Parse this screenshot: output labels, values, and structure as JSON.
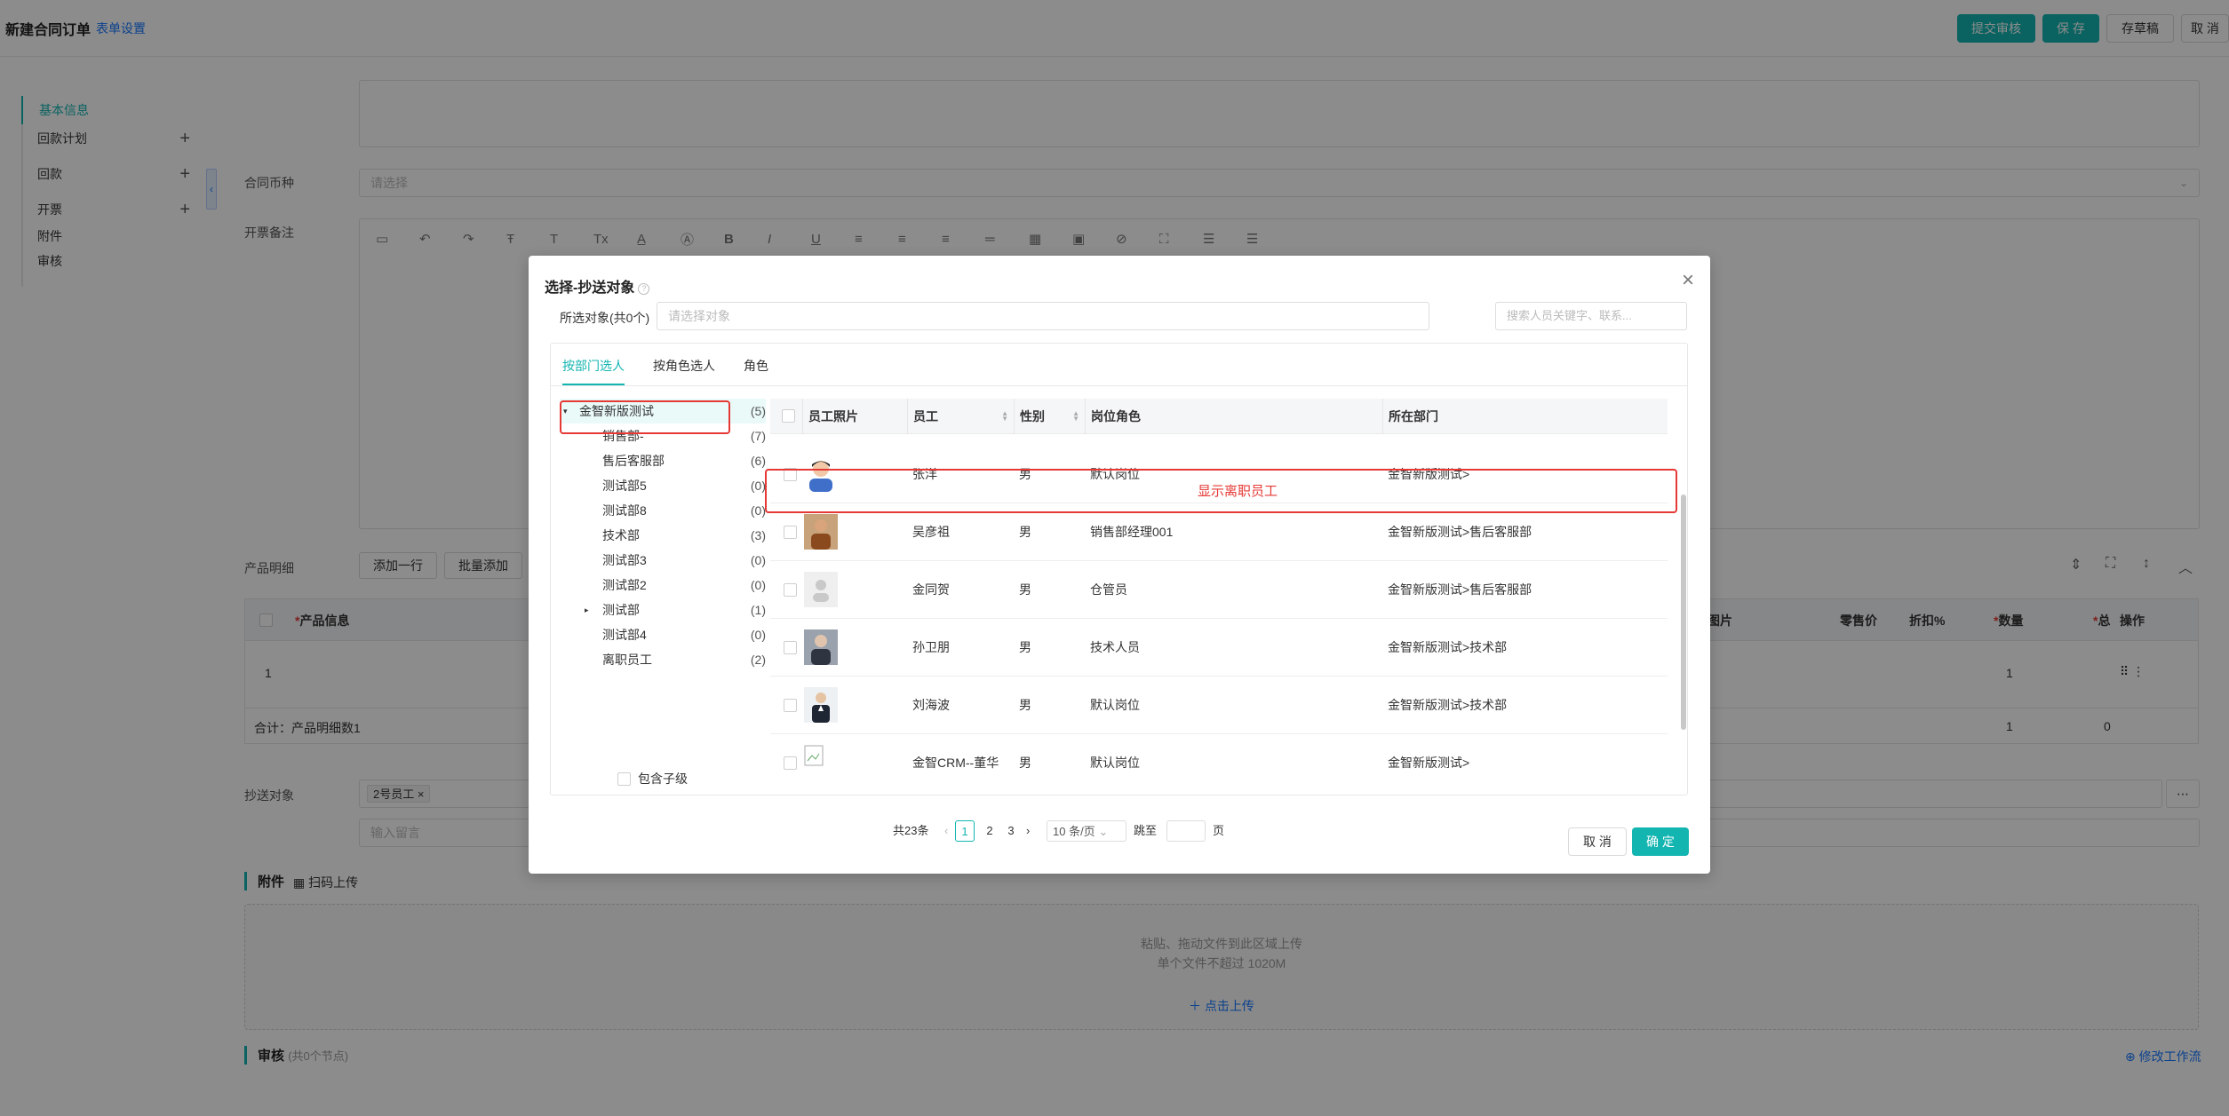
{
  "page": {
    "title": "新建合同订单",
    "form_settings": "表单设置",
    "buttons": {
      "submit": "提交审核",
      "save": "保 存",
      "draft": "存草稿",
      "cancel": "取 消"
    },
    "side_nav": [
      {
        "label": "基本信息",
        "active": true,
        "plus": false
      },
      {
        "label": "回款计划",
        "active": false,
        "plus": true
      },
      {
        "label": "回款",
        "active": false,
        "plus": true
      },
      {
        "label": "开票",
        "active": false,
        "plus": true
      },
      {
        "label": "附件",
        "active": false,
        "plus": false
      },
      {
        "label": "审核",
        "active": false,
        "plus": false
      }
    ],
    "currency_label": "合同币种",
    "currency_placeholder": "请选择",
    "invoice_note_label": "开票备注",
    "product_detail_label": "产品明细",
    "add_row": "添加一行",
    "batch_add": "批量添加",
    "grid_headers": {
      "product": "产品信息",
      "photo": "图片",
      "price": "零售价",
      "discount": "折扣%",
      "qty": "数量",
      "total": "总",
      "action": "操作"
    },
    "grid_row": {
      "index": "1",
      "qty": "1"
    },
    "grid_total": {
      "label": "合计：产品明细数1",
      "qty": "1",
      "total": "0"
    },
    "cc_label": "抄送对象",
    "cc_tag": "2号员工",
    "message_placeholder": "输入留言",
    "attachment_title": "附件",
    "scan_upload": "扫码上传",
    "upload_hint1": "粘贴、拖动文件到此区域上传",
    "upload_hint2": "单个文件不超过 1020M",
    "upload_link": "点击上传",
    "review_title": "审核",
    "review_sub": "(共0个节点)",
    "edit_workflow": "修改工作流"
  },
  "modal": {
    "title": "选择-抄送对象",
    "selected_label": "所选对象(共0个)",
    "selected_placeholder": "请选择对象",
    "search_placeholder": "搜索人员关键字、联系...",
    "tabs": [
      "按部门选人",
      "按角色选人",
      "角色"
    ],
    "tree": [
      {
        "label": "金智新版测试",
        "count": "(5)",
        "level": 0,
        "expanded": true,
        "root": true
      },
      {
        "label": "销售部-",
        "count": "(7)",
        "level": 1
      },
      {
        "label": "售后客服部",
        "count": "(6)",
        "level": 1
      },
      {
        "label": "测试部5",
        "count": "(0)",
        "level": 1
      },
      {
        "label": "测试部8",
        "count": "(0)",
        "level": 1
      },
      {
        "label": "技术部",
        "count": "(3)",
        "level": 1
      },
      {
        "label": "测试部3",
        "count": "(0)",
        "level": 1
      },
      {
        "label": "测试部2",
        "count": "(0)",
        "level": 1
      },
      {
        "label": "测试部",
        "count": "(1)",
        "level": 1,
        "collapsed": true
      },
      {
        "label": "测试部4",
        "count": "(0)",
        "level": 1
      },
      {
        "label": "离职员工",
        "count": "(2)",
        "level": 1
      }
    ],
    "include_sub": "包含子级",
    "columns": {
      "photo": "员工照片",
      "name": "员工",
      "gender": "性别",
      "role": "岗位角色",
      "dept": "所在部门"
    },
    "rows": [
      {
        "name": "张洋",
        "gender": "男",
        "role": "默认岗位",
        "dept": "金智新版测试>",
        "photo": "boy"
      },
      {
        "name": "吴彦祖",
        "gender": "男",
        "role": "销售部经理001",
        "dept": "金智新版测试>售后客服部",
        "photo": "man-brown"
      },
      {
        "name": "金同贺",
        "gender": "男",
        "role": "仓管员",
        "dept": "金智新版测试>售后客服部",
        "photo": "default-avatar"
      },
      {
        "name": "孙卫朋",
        "gender": "男",
        "role": "技术人员",
        "dept": "金智新版测试>技术部",
        "photo": "man-gray"
      },
      {
        "name": "刘海波",
        "gender": "男",
        "role": "默认岗位",
        "dept": "金智新版测试>技术部",
        "photo": "man-suit"
      },
      {
        "name": "金智CRM--董华",
        "gender": "男",
        "role": "默认岗位",
        "dept": "金智新版测试>",
        "photo": "broken-image"
      }
    ],
    "annotation": "显示离职员工",
    "pager": {
      "total": "共23条",
      "pages": [
        "1",
        "2",
        "3"
      ],
      "page_size": "10 条/页",
      "jump": "跳至",
      "page_unit": "页"
    },
    "cancel": "取 消",
    "ok": "确 定"
  },
  "colors": {
    "accent": "#13b5b1",
    "annotation": "#e53935",
    "link": "#1677ff"
  }
}
